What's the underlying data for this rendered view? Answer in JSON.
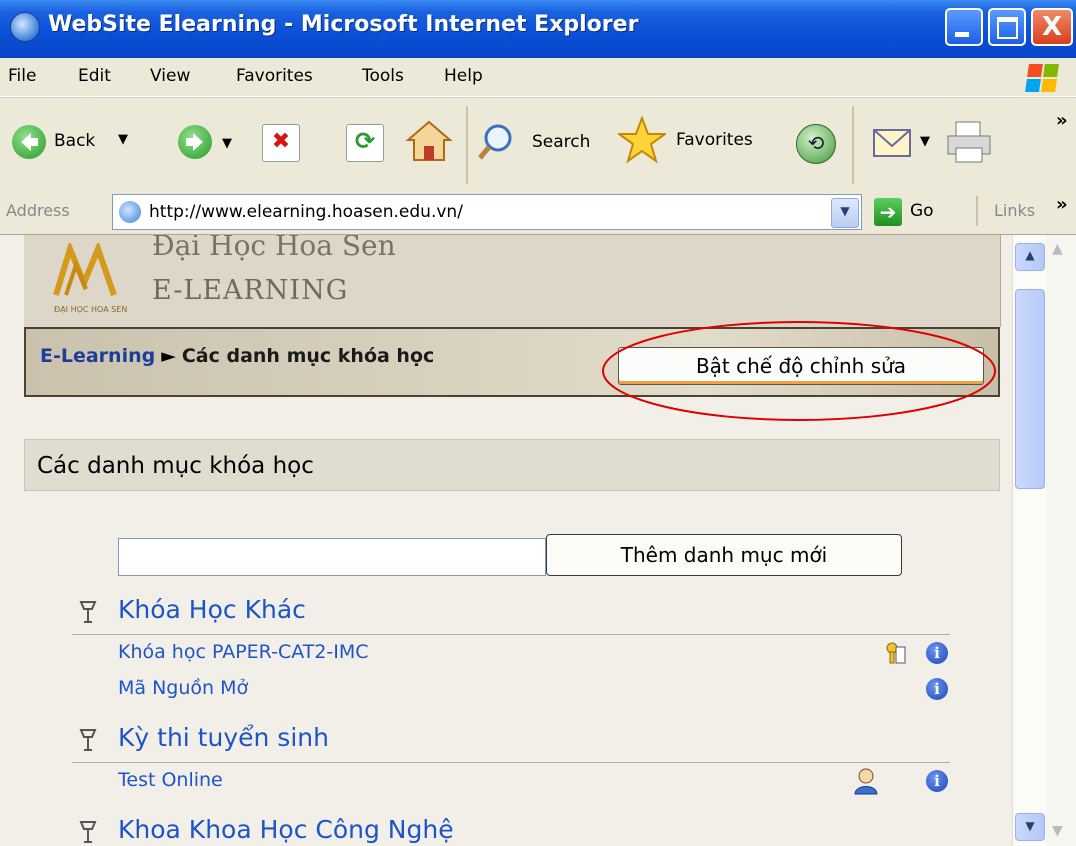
{
  "window": {
    "title": "WebSite Elearning - Microsoft Internet Explorer",
    "close_glyph": "X"
  },
  "menu": [
    "File",
    "Edit",
    "View",
    "Favorites",
    "Tools",
    "Help"
  ],
  "toolbar": {
    "back_label": "Back",
    "search_label": "Search",
    "favorites_label": "Favorites",
    "overflow": "»"
  },
  "address": {
    "label": "Address",
    "url": "http://www.elearning.hoasen.edu.vn/",
    "go_label": "Go",
    "links_label": "Links",
    "links_overflow": "»"
  },
  "site": {
    "name_line1": "Đại Học Hoa Sen",
    "name_line2": "E-LEARNING",
    "logo_text": "ĐẠI HỌC HOA SEN"
  },
  "breadcrumb": {
    "home": "E-Learning",
    "separator": "►",
    "current": "Các danh mục khóa học"
  },
  "edit_button": "Bật chế độ chỉnh sửa",
  "section_title": "Các danh mục khóa học",
  "add_category": {
    "value": "",
    "button": "Thêm danh mục mới"
  },
  "categories": [
    {
      "title": "Khóa Học Khác",
      "courses": [
        {
          "name": "Khóa học PAPER-CAT2-IMC",
          "icons": [
            "key-icon",
            "info-icon"
          ]
        },
        {
          "name": "Mã Nguồn Mở",
          "icons": [
            "info-icon"
          ]
        }
      ]
    },
    {
      "title": "Kỳ thi tuyển sinh",
      "courses": [
        {
          "name": "Test Online",
          "icons": [
            "guest-icon",
            "info-icon"
          ]
        }
      ]
    },
    {
      "title": "Khoa Khoa Học Công Nghệ",
      "courses": []
    }
  ],
  "colors": {
    "link": "#1f54c8",
    "titlebar": "#0a4fd6",
    "highlight_ellipse": "#e00000"
  }
}
